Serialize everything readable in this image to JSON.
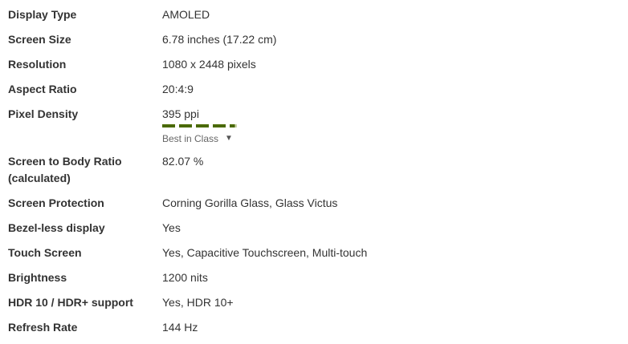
{
  "specs": [
    {
      "label": "Display Type",
      "value": "AMOLED"
    },
    {
      "label": "Screen Size",
      "value": "6.78 inches (17.22 cm)"
    },
    {
      "label": "Resolution",
      "value": "1080 x 2448 pixels"
    },
    {
      "label": "Aspect Ratio",
      "value": "20:4:9"
    },
    {
      "label": "Pixel Density",
      "value": "395 ppi",
      "rating": {
        "filled_segments": 4.7,
        "total_segments": 5
      },
      "link": "Best in Class"
    },
    {
      "label": "Screen to Body Ratio (calculated)",
      "value": "82.07 %"
    },
    {
      "label": "Screen Protection",
      "value": "Corning Gorilla Glass, Glass Victus"
    },
    {
      "label": "Bezel-less display",
      "value": "Yes"
    },
    {
      "label": "Touch Screen",
      "value": "Yes, Capacitive Touchscreen, Multi-touch"
    },
    {
      "label": "Brightness",
      "value": "1200 nits"
    },
    {
      "label": "HDR 10 / HDR+ support",
      "value": "Yes, HDR 10+"
    },
    {
      "label": "Refresh Rate",
      "value": "144 Hz"
    }
  ],
  "colors": {
    "rating_fill": "#4a6a00",
    "rating_empty": "#c8d3a8",
    "label_text": "#333333",
    "link_text": "#666666"
  },
  "icons": {
    "dropdown": "caret-down-icon"
  }
}
